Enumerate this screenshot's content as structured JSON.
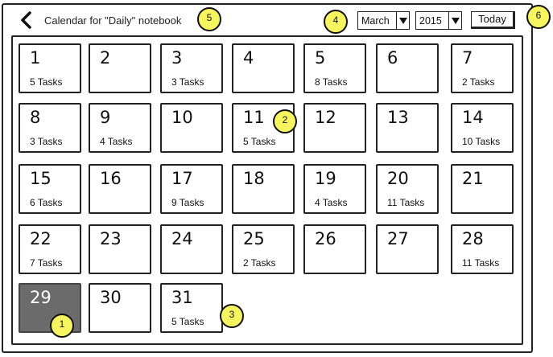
{
  "header": {
    "title": "Calendar for \"Daily\" notebook",
    "month": "March",
    "year": "2015",
    "today_label": "Today"
  },
  "callouts": [
    "1",
    "2",
    "3",
    "4",
    "5",
    "6"
  ],
  "days": [
    {
      "day": "1",
      "tasks": "5 Tasks"
    },
    {
      "day": "2",
      "tasks": ""
    },
    {
      "day": "3",
      "tasks": "3 Tasks"
    },
    {
      "day": "4",
      "tasks": ""
    },
    {
      "day": "5",
      "tasks": "8 Tasks"
    },
    {
      "day": "6",
      "tasks": ""
    },
    {
      "day": "7",
      "tasks": "2 Tasks"
    },
    {
      "day": "8",
      "tasks": "3 Tasks"
    },
    {
      "day": "9",
      "tasks": "4 Tasks"
    },
    {
      "day": "10",
      "tasks": ""
    },
    {
      "day": "11",
      "tasks": "5 Tasks"
    },
    {
      "day": "12",
      "tasks": ""
    },
    {
      "day": "13",
      "tasks": ""
    },
    {
      "day": "14",
      "tasks": "10 Tasks"
    },
    {
      "day": "15",
      "tasks": "6 Tasks"
    },
    {
      "day": "16",
      "tasks": ""
    },
    {
      "day": "17",
      "tasks": "9 Tasks"
    },
    {
      "day": "18",
      "tasks": ""
    },
    {
      "day": "19",
      "tasks": "4 Tasks"
    },
    {
      "day": "20",
      "tasks": "11 Tasks"
    },
    {
      "day": "21",
      "tasks": ""
    },
    {
      "day": "22",
      "tasks": "7 Tasks"
    },
    {
      "day": "23",
      "tasks": ""
    },
    {
      "day": "24",
      "tasks": ""
    },
    {
      "day": "25",
      "tasks": "2 Tasks"
    },
    {
      "day": "26",
      "tasks": ""
    },
    {
      "day": "27",
      "tasks": ""
    },
    {
      "day": "28",
      "tasks": "11 Tasks"
    },
    {
      "day": "29",
      "tasks": ""
    },
    {
      "day": "30",
      "tasks": ""
    },
    {
      "day": "31",
      "tasks": "5 Tasks"
    }
  ],
  "selected_day": "29",
  "colors": {
    "selected_cell": "#6b6b6b",
    "callout": "#f6f55f",
    "border": "#222222"
  }
}
